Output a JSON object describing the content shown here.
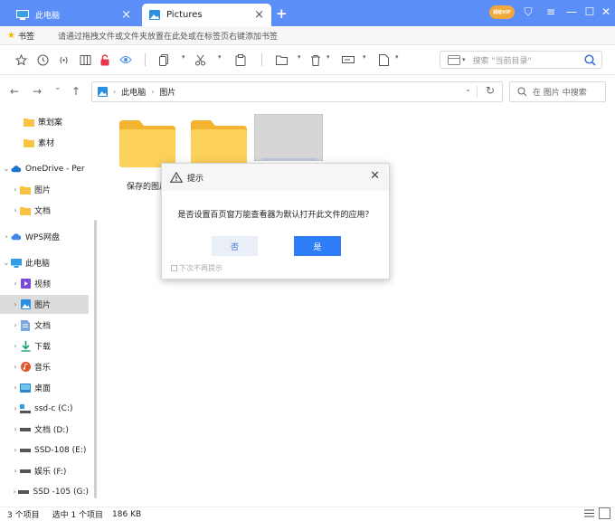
{
  "tabs": [
    {
      "label": "此电脑",
      "close": "×"
    },
    {
      "label": "Pictures",
      "close": "×"
    }
  ],
  "new_tab": "+",
  "vip_badge": "超级VIP",
  "window_buttons": [
    "⛉",
    "≡",
    "—",
    "☐",
    "✕"
  ],
  "bookmarks": {
    "label": "书签",
    "hint": "请通过拖拽文件或文件夹放置在此处或在标签页右键添加书签"
  },
  "search_top": {
    "placeholder": "搜索 \"当前目录\""
  },
  "nav": {
    "back": "←",
    "forward": "→",
    "history": "⌄",
    "up": "↑",
    "breadcrumbs": [
      "此电脑",
      "图片"
    ],
    "crumb_sep": "›",
    "dropdown": "⌄",
    "refresh": "↻",
    "search_placeholder": "在 图片 中搜索"
  },
  "sidebar": [
    {
      "label": "策划案",
      "icon": "folder"
    },
    {
      "label": "素材",
      "icon": "folder"
    },
    {
      "label": "OneDrive - Per",
      "icon": "cloud",
      "expanded": true
    },
    {
      "label": "图片",
      "icon": "folder"
    },
    {
      "label": "文档",
      "icon": "folder"
    },
    {
      "label": "WPS网盘",
      "icon": "cloud"
    },
    {
      "label": "此电脑",
      "icon": "pc",
      "expanded": true
    },
    {
      "label": "视频",
      "icon": "video"
    },
    {
      "label": "图片",
      "icon": "picture",
      "selected": true
    },
    {
      "label": "文档",
      "icon": "doc"
    },
    {
      "label": "下载",
      "icon": "download"
    },
    {
      "label": "音乐",
      "icon": "music"
    },
    {
      "label": "桌面",
      "icon": "desktop"
    },
    {
      "label": "ssd-c (C:)",
      "icon": "drive"
    },
    {
      "label": "文档 (D:)",
      "icon": "drive"
    },
    {
      "label": "SSD-108 (E:)",
      "icon": "drive"
    },
    {
      "label": "娱乐 (F:)",
      "icon": "drive"
    },
    {
      "label": "SSD -105 (G:)",
      "icon": "drive"
    }
  ],
  "files": [
    {
      "name": "保存的图片",
      "type": "folder"
    },
    {
      "name": "",
      "type": "folder"
    },
    {
      "name": "",
      "type": "image"
    }
  ],
  "status": {
    "count": "3 个项目",
    "selected": "选中 1 个项目",
    "size": "186 KB"
  },
  "dialog": {
    "title": "提示",
    "close": "✕",
    "message": "是否设置百页窗万能查看器为默认打开此文件的应用？",
    "no": "否",
    "yes": "是",
    "dont_show": "下次不再提示"
  },
  "colors": {
    "tabbar": "#5b8ff7",
    "accent": "#2f7df7",
    "folder": "#f8c244",
    "selected": "#dcdcdc"
  }
}
